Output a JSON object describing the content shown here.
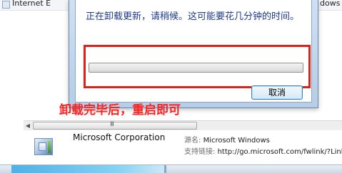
{
  "background_list": {
    "item_label": "Internet E",
    "right_text": "dows"
  },
  "dialog": {
    "message": "正在卸载更新，请稍候。这可能要花几分钟的时间。",
    "progress": 0,
    "cancel_label": "取消"
  },
  "annotation": {
    "text": "卸载完毕后，重启即可"
  },
  "details": {
    "publisher": "Microsoft Corporation",
    "source_label": "源名:",
    "source_value": "Microsoft Windows",
    "support_label": "支持链接:",
    "support_value": "http://go.microsoft.com/fwlink/?Link"
  },
  "scrollbar": {
    "grip": "III"
  },
  "colors": {
    "annotation": "#ff2020",
    "highlight_border": "#e0211b",
    "message_text": "#1e3a8a"
  }
}
